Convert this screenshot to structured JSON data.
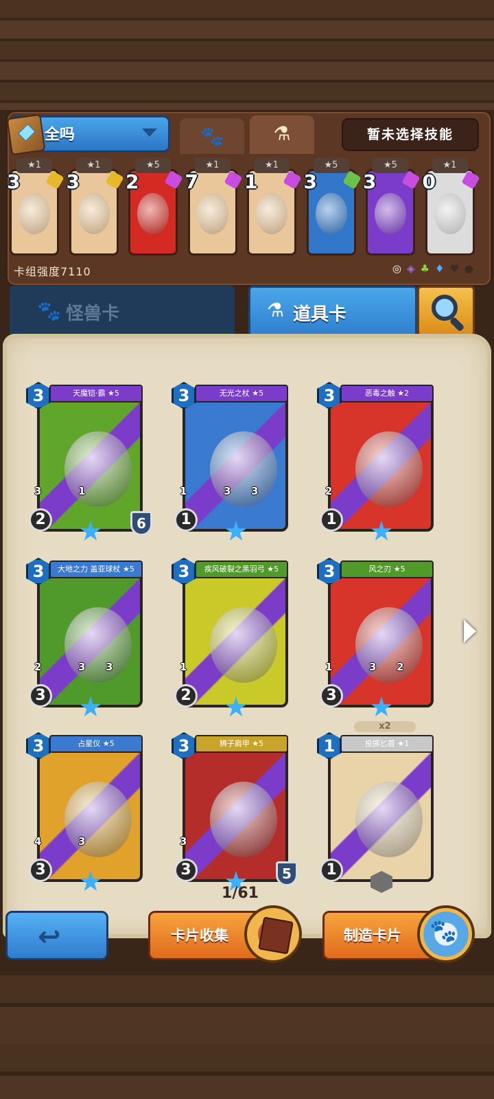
{
  "deck": {
    "name": "全吗",
    "skill_button": "暂未选择技能",
    "strength_label": "卡组强度7110",
    "tabs": [
      {
        "icon": "paw-icon"
      },
      {
        "icon": "potion-icon"
      }
    ],
    "cards": [
      {
        "count": "3",
        "stars": "★1",
        "color": "#e9c79a"
      },
      {
        "count": "3",
        "stars": "★1",
        "color": "#e9c79a"
      },
      {
        "count": "2",
        "stars": "★5",
        "color": "#d42a24"
      },
      {
        "count": "7",
        "stars": "★1",
        "color": "#e9c79a"
      },
      {
        "count": "1",
        "stars": "★1",
        "color": "#e9c79a"
      },
      {
        "count": "3",
        "stars": "★5",
        "color": "#3277c9"
      },
      {
        "count": "3",
        "stars": "★5",
        "color": "#7b3cc9"
      },
      {
        "count": "0",
        "stars": "★1",
        "color": "#dcdcdc"
      }
    ],
    "resource_icons": [
      "◎",
      "◈",
      "♣",
      "♦",
      "♥",
      "●"
    ]
  },
  "categories": {
    "monster": "怪兽卡",
    "item": "道具卡"
  },
  "cards": [
    {
      "name": "天魔铠·霸 ★5",
      "cost": "3",
      "stats": [
        "2",
        "3",
        "1"
      ],
      "shield": "6",
      "ribbon": "#7b3cc9",
      "bg": "#5fa62a"
    },
    {
      "name": "无光之杖 ★5",
      "cost": "3",
      "stats": [
        "1",
        "1",
        "3",
        "3"
      ],
      "ribbon": "#7b3cc9",
      "bg": "#3a7ad1"
    },
    {
      "name": "恶毒之触 ★2",
      "cost": "3",
      "stats": [
        "1",
        "2"
      ],
      "ribbon": "#7b3cc9",
      "bg": "#d7342a"
    },
    {
      "name": "大地之力 盖亚球杖 ★5",
      "cost": "3",
      "stats": [
        "3",
        "2",
        "3",
        "3"
      ],
      "ribbon": "#3a7ad1",
      "bg": "#4f9a2b"
    },
    {
      "name": "疾风破裂之黑羽弓 ★5",
      "cost": "3",
      "stats": [
        "2",
        "1"
      ],
      "ribbon": "#4f9a2b",
      "bg": "#c9c92a"
    },
    {
      "name": "风之刃 ★5",
      "cost": "3",
      "stats": [
        "3",
        "1",
        "3",
        "2"
      ],
      "ribbon": "#4f9a2b",
      "bg": "#d7342a"
    },
    {
      "name": "占星仪 ★5",
      "cost": "3",
      "stats": [
        "3",
        "4",
        "3"
      ],
      "ribbon": "#3a7ad1",
      "bg": "#e0a22a"
    },
    {
      "name": "狮子肩甲 ★5",
      "cost": "3",
      "stats": [
        "3",
        "3"
      ],
      "shield": "5",
      "ribbon": "#c9a42a",
      "bg": "#b52d2a"
    },
    {
      "name": "投掷匕首 ★1",
      "cost": "1",
      "stats": [
        "1"
      ],
      "ribbon": "#c8c8c8",
      "bg": "#e9d3a8",
      "badge": "x2"
    }
  ],
  "page_indicator": "1/61",
  "buttons": {
    "collect": "卡片收集",
    "craft": "制造卡片"
  }
}
